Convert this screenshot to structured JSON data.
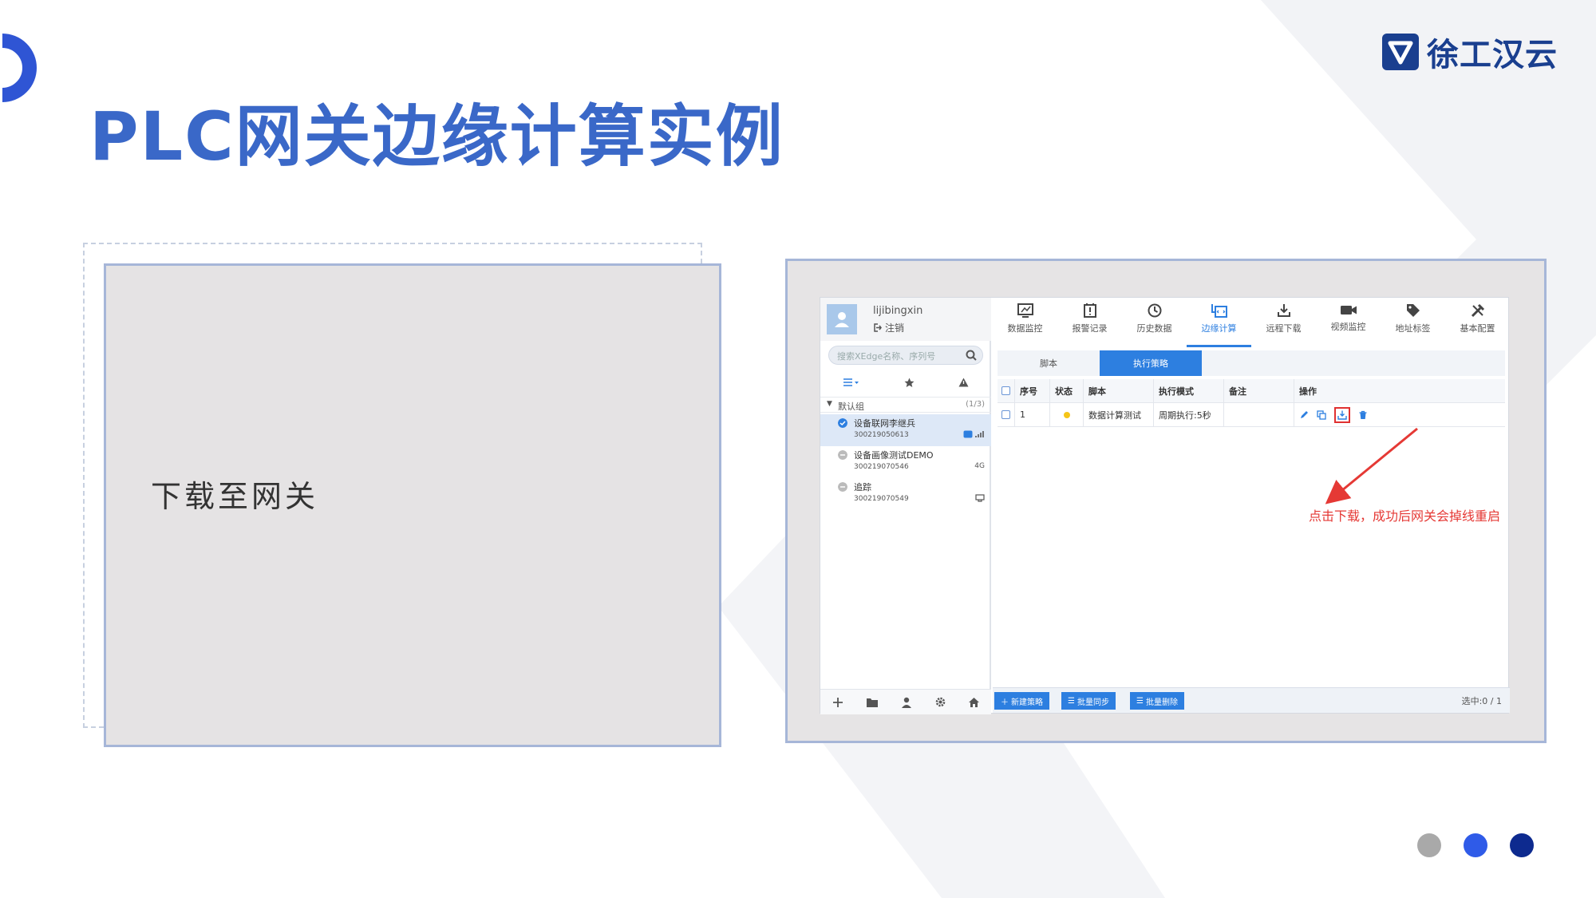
{
  "brand": {
    "name": "徐工汉云",
    "color": "#1a3f8f"
  },
  "slide": {
    "title": "PLC网关边缘计算实例",
    "left_text": "下载至网关",
    "pager_colors": [
      "#a9a9a9",
      "#2f5be8",
      "#0d2a8f"
    ]
  },
  "app": {
    "user": {
      "name": "lijibingxin",
      "logout": "注销"
    },
    "search": {
      "placeholder": "搜索XEdge名称、序列号"
    },
    "group": {
      "name": "默认组",
      "count": "(1/3)"
    },
    "devices": [
      {
        "name": "设备联网李继兵",
        "serial": "300219050613",
        "badge": "",
        "status": "online",
        "selected": true
      },
      {
        "name": "设备画像测试DEMO",
        "serial": "300219070546",
        "badge": "4G",
        "status": "offline",
        "selected": false
      },
      {
        "name": "追踪",
        "serial": "300219070549",
        "badge": "",
        "status": "offline",
        "selected": false
      }
    ],
    "nav": [
      {
        "label": "数据监控",
        "icon": "monitor-icon"
      },
      {
        "label": "报警记录",
        "icon": "alarm-icon"
      },
      {
        "label": "历史数据",
        "icon": "history-icon"
      },
      {
        "label": "边缘计算",
        "icon": "edge-compute-icon",
        "active": true
      },
      {
        "label": "远程下载",
        "icon": "download-icon"
      },
      {
        "label": "视频监控",
        "icon": "video-icon"
      },
      {
        "label": "地址标签",
        "icon": "tag-icon"
      },
      {
        "label": "基本配置",
        "icon": "tools-icon"
      }
    ],
    "tabs": [
      {
        "label": "脚本",
        "active": false
      },
      {
        "label": "执行策略",
        "active": true
      }
    ],
    "table": {
      "headers": [
        "序号",
        "状态",
        "脚本",
        "执行模式",
        "备注",
        "操作"
      ],
      "rows": [
        {
          "index": "1",
          "status": "pending",
          "script": "数据计算测试",
          "mode": "周期执行:5秒",
          "note": ""
        }
      ]
    },
    "annotation": "点击下载，成功后网关会掉线重启",
    "buttons": {
      "new": "新建策略",
      "sync": "批量同步",
      "delete": "批量删除"
    },
    "selection": "选中:0 / 1"
  }
}
